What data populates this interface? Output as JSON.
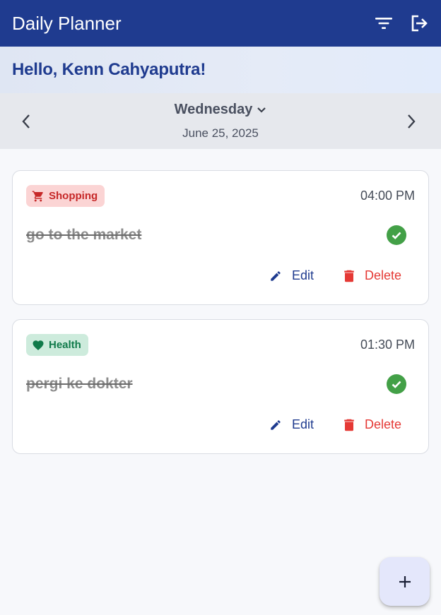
{
  "app": {
    "title": "Daily Planner",
    "accent_color": "#1f3b8f",
    "actions": [
      {
        "icon": "filter-icon"
      },
      {
        "icon": "logout-icon"
      }
    ]
  },
  "greeting": {
    "text": "Hello, Kenn Cahyaputra!"
  },
  "date_nav": {
    "day": "Wednesday",
    "date": "June 25, 2025",
    "prev_icon": "chevron-left-icon",
    "next_icon": "chevron-right-icon",
    "dropdown_icon": "chevron-down-icon"
  },
  "tasks": [
    {
      "category": "Shopping",
      "category_icon": "shopping-cart-icon",
      "category_color": "#c62828",
      "time": "04:00 PM",
      "title": "go to the market",
      "completed": true,
      "edit_label": "Edit",
      "delete_label": "Delete"
    },
    {
      "category": "Health",
      "category_icon": "heart-icon",
      "category_color": "#107a4a",
      "time": "01:30 PM",
      "title": "pergi ke dokter",
      "completed": true,
      "edit_label": "Edit",
      "delete_label": "Delete"
    }
  ],
  "fab": {
    "icon": "add-icon"
  }
}
